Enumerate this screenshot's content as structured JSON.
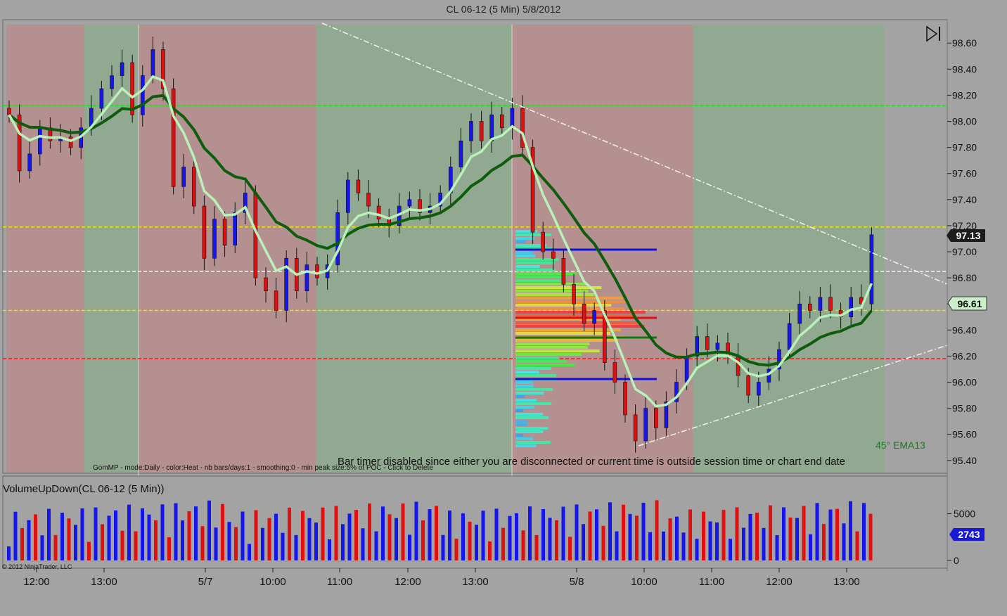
{
  "window": {
    "title": "CL 06-12 (5 Min)  5/8/2012"
  },
  "colors": {
    "up": "#1515ee",
    "down": "#e01010",
    "session_red": "#b59090",
    "session_green": "#91a891",
    "ema_dark": "#0d5d0d",
    "ema_light": "#b8f2b8",
    "level_green": "#22dd22",
    "level_yellow": "#f0e010",
    "level_white": "#f4f4f4",
    "level_red": "#ee1818"
  },
  "chart_data": [
    {
      "type": "candlestick",
      "title": "CL 06-12 (5 Min)  5/8/2012",
      "ylim": [
        95.3,
        98.75
      ],
      "y_ticks": [
        "98.60",
        "98.40",
        "98.20",
        "98.00",
        "97.80",
        "97.60",
        "97.40",
        "97.20",
        "97.00",
        "96.80",
        "96.60",
        "96.40",
        "96.20",
        "96.00",
        "95.80",
        "95.60",
        "95.40"
      ],
      "x_ticks": [
        "12:00",
        "13:00",
        "5/7",
        "10:00",
        "11:00",
        "12:00",
        "13:00",
        "5/8",
        "10:00",
        "11:00",
        "12:00",
        "13:00"
      ],
      "current_price": "97.13",
      "ema_value": "96.61",
      "indicator_label": "45° EMA13",
      "profile_note": "GomMP - mode:Daily  - color:Heat - nb bars/days:1  - smoothing:0 - min peak size:5% of POC - Click to Delete",
      "timer_message": "Bar timer disabled since either you are disconnected or current time is outside session time or chart end date",
      "horizontal_levels": [
        98.12,
        97.19,
        96.85,
        96.55,
        96.18
      ],
      "close_path": [
        [
          98.1,
          98.05
        ],
        [
          98.05,
          97.62
        ],
        [
          97.62,
          97.75
        ],
        [
          97.75,
          97.95
        ],
        [
          97.95,
          97.85
        ],
        [
          97.85,
          97.88
        ],
        [
          97.88,
          97.8
        ],
        [
          97.8,
          97.95
        ],
        [
          97.95,
          98.1
        ],
        [
          98.1,
          98.25
        ],
        [
          98.25,
          98.35
        ],
        [
          98.35,
          98.45
        ],
        [
          98.45,
          98.05
        ],
        [
          98.05,
          98.35
        ],
        [
          98.35,
          98.55
        ],
        [
          98.55,
          98.25
        ],
        [
          98.25,
          97.5
        ],
        [
          97.5,
          97.65
        ],
        [
          97.65,
          97.35
        ],
        [
          97.35,
          96.95
        ],
        [
          96.95,
          97.25
        ],
        [
          97.25,
          97.05
        ],
        [
          97.05,
          97.3
        ],
        [
          97.3,
          97.45
        ],
        [
          97.45,
          96.8
        ],
        [
          96.8,
          96.7
        ],
        [
          96.7,
          96.55
        ],
        [
          96.55,
          96.95
        ],
        [
          96.95,
          96.7
        ],
        [
          96.7,
          96.9
        ],
        [
          96.9,
          96.8
        ],
        [
          96.8,
          96.9
        ],
        [
          96.9,
          97.3
        ],
        [
          97.3,
          97.55
        ],
        [
          97.55,
          97.45
        ],
        [
          97.45,
          97.35
        ],
        [
          97.35,
          97.25
        ],
        [
          97.25,
          97.2
        ],
        [
          97.2,
          97.35
        ],
        [
          97.35,
          97.4
        ],
        [
          97.4,
          97.3
        ],
        [
          97.3,
          97.35
        ],
        [
          97.35,
          97.45
        ],
        [
          97.45,
          97.65
        ],
        [
          97.65,
          97.85
        ],
        [
          97.85,
          98.0
        ],
        [
          98.0,
          97.85
        ],
        [
          97.85,
          98.05
        ],
        [
          98.05,
          97.95
        ],
        [
          97.95,
          98.1
        ],
        [
          98.1,
          97.8
        ],
        [
          97.8,
          97.15
        ],
        [
          97.15,
          97.0
        ],
        [
          97.0,
          96.95
        ],
        [
          96.95,
          96.75
        ],
        [
          96.75,
          96.6
        ],
        [
          96.6,
          96.45
        ],
        [
          96.45,
          96.55
        ],
        [
          96.55,
          96.15
        ],
        [
          96.15,
          96.0
        ],
        [
          96.0,
          95.75
        ],
        [
          95.75,
          95.55
        ],
        [
          95.55,
          95.8
        ],
        [
          95.8,
          95.65
        ],
        [
          95.65,
          95.85
        ],
        [
          95.85,
          96.0
        ],
        [
          96.0,
          96.2
        ],
        [
          96.2,
          96.35
        ],
        [
          96.35,
          96.25
        ],
        [
          96.25,
          96.3
        ],
        [
          96.3,
          96.2
        ],
        [
          96.2,
          96.05
        ],
        [
          96.05,
          95.9
        ],
        [
          95.9,
          96.0
        ],
        [
          96.0,
          96.1
        ],
        [
          96.1,
          96.25
        ],
        [
          96.25,
          96.45
        ],
        [
          96.45,
          96.6
        ],
        [
          96.6,
          96.55
        ],
        [
          96.55,
          96.65
        ],
        [
          96.65,
          96.55
        ],
        [
          96.55,
          96.5
        ],
        [
          96.5,
          96.65
        ],
        [
          96.65,
          96.6
        ],
        [
          96.6,
          97.13
        ]
      ]
    },
    {
      "type": "bar",
      "title": "VolumeUpDown(CL 06-12 (5 Min))",
      "y_ticks": [
        "5000",
        "0"
      ],
      "last_value": "2743"
    }
  ],
  "footer": {
    "copyright": "© 2012 NinjaTrader, LLC"
  }
}
